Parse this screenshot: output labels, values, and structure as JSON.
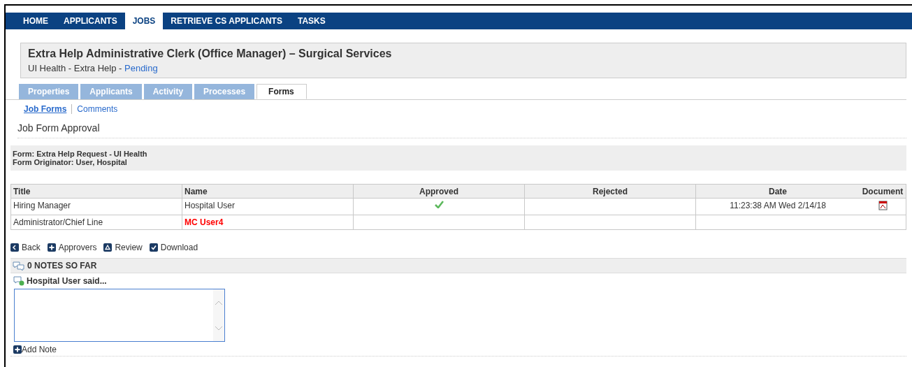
{
  "nav": [
    {
      "label": "HOME",
      "selected": false
    },
    {
      "label": "APPLICANTS",
      "selected": false
    },
    {
      "label": "JOBS",
      "selected": true
    },
    {
      "label": "RETRIEVE CS APPLICANTS",
      "selected": false
    },
    {
      "label": "TASKS",
      "selected": false
    }
  ],
  "job": {
    "title": "Extra Help Administrative Clerk (Office Manager) – Surgical Services",
    "subtitle": "UI Health - Extra Help - ",
    "status": "Pending"
  },
  "tabs": [
    {
      "label": "Properties",
      "selected": false
    },
    {
      "label": "Applicants",
      "selected": false
    },
    {
      "label": "Activity",
      "selected": false
    },
    {
      "label": "Processes",
      "selected": false
    },
    {
      "label": "Forms",
      "selected": true
    }
  ],
  "subnav": [
    {
      "label": "Job Forms",
      "selected": true
    },
    {
      "label": "Comments",
      "selected": false
    }
  ],
  "section_title": "Job Form Approval",
  "form_info": [
    "Form: Extra Help Request - UI Health",
    "Form Originator: User, Hospital"
  ],
  "table": {
    "columns": [
      "Title",
      "Name",
      "Approved",
      "Rejected",
      "Date",
      "Document"
    ],
    "rows": [
      {
        "title": "Hiring Manager",
        "name": "Hospital User",
        "pending": false,
        "approved": true,
        "date": "11:23:38 AM Wed 2/14/18",
        "document": true
      },
      {
        "title": "Administrator/Chief Line",
        "name": "MC User4",
        "pending": true,
        "approved": false,
        "document": false
      }
    ]
  },
  "actions": [
    {
      "kind": "back",
      "label": "Back"
    },
    {
      "kind": "plus",
      "label": "Approvers"
    },
    {
      "kind": "review",
      "label": "Review"
    },
    {
      "kind": "check",
      "label": "Download"
    }
  ],
  "notes": {
    "header": "0 NOTES SO FAR",
    "author": "Hospital User said...",
    "add": "Add Note"
  }
}
